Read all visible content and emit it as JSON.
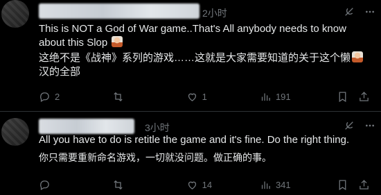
{
  "posts": [
    {
      "time": "2小时",
      "text_en": "This is NOT a God of War game..That's All anybody needs to know about this Slop",
      "text_zh_part1": "这绝不是《战神》系列的游戏……这就是大家需要知道的关于这个懒",
      "text_zh_part2": "汉的全部",
      "actions": {
        "replies": "2",
        "reposts": "",
        "likes": "1",
        "views": "191"
      }
    },
    {
      "time": "3小时",
      "text_en": "All you have to do is retitle the game and it's fine. Do the right thing.",
      "text_zh": "你只需要重新命名游戏，一切就没问题。做正确的事。",
      "actions": {
        "replies": "",
        "reposts": "",
        "likes": "14",
        "views": "341"
      }
    }
  ],
  "icons": [
    "grok-icon",
    "more-icon",
    "reply-icon",
    "repost-icon",
    "like-icon",
    "views-icon",
    "bookmark-icon",
    "share-icon"
  ]
}
